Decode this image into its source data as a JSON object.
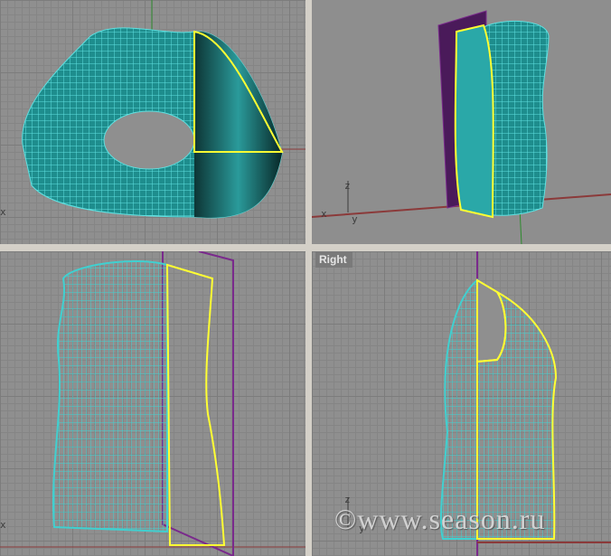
{
  "viewports": {
    "top_left": {
      "axis_x": "x"
    },
    "top_right": {
      "axis_z": "z",
      "axis_x": "x",
      "axis_y": "y"
    },
    "bottom_left": {
      "axis_x": "x"
    },
    "bottom_right": {
      "label": "Right",
      "axis_z": "z",
      "axis_y": "y"
    }
  },
  "watermark": "©www.season.ru",
  "colors": {
    "wire": "#3ccfcf",
    "selection": "#ffff33",
    "plane": "#7a2a8c",
    "x_axis": "#8b3a3a",
    "y_axis": "#2e8b2e"
  }
}
